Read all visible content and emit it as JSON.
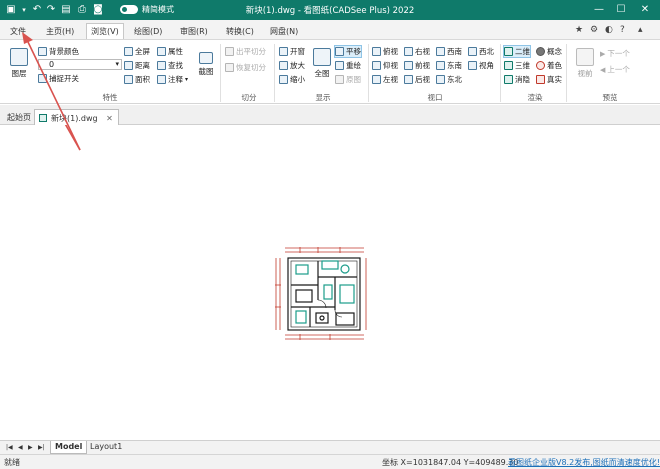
{
  "titlebar": {
    "title": "新块(1).dwg - 看图纸(CADSee Plus) 2022",
    "mode_label": "精简模式",
    "icons": [
      "folder-icon",
      "undo-icon",
      "redo-icon",
      "save-icon",
      "print-icon",
      "camera-icon",
      "minimize-icon",
      "maximize-icon",
      "close-icon"
    ]
  },
  "menu": {
    "tabs": [
      "文件",
      "主页(H)",
      "浏览(V)",
      "绘图(D)",
      "审图(R)",
      "转换(C)",
      "网盘(N)"
    ],
    "active": "浏览(V)"
  },
  "ribbon": {
    "properties": {
      "label": "特性",
      "layer_btn": "图层",
      "bg_color": "背景颜色",
      "layer_value": "0",
      "snap": "捕捉开关",
      "fullscreen": "全屏",
      "attribute": "属性",
      "distance": "距离",
      "find": "查找",
      "area": "面积",
      "annotate": "注释",
      "screenshot": "截图"
    },
    "split": {
      "label": "切分",
      "out_split": "出平切分",
      "restore_split": "恢复切分"
    },
    "display": {
      "label": "显示",
      "window": "开窗",
      "zoom_in": "放大",
      "zoom_out": "缩小",
      "full_view": "全图",
      "pan": "平移",
      "redraw": "重绘",
      "original": "原图"
    },
    "viewport": {
      "label": "视口",
      "items": [
        "俯视",
        "右视",
        "西南",
        "西北",
        "仰视",
        "前视",
        "东南",
        "视角",
        "左视",
        "后视",
        "东北"
      ]
    },
    "render": {
      "label": "渲染",
      "items": [
        "二维",
        "概念",
        "三维",
        "着色",
        "消隐",
        "真实"
      ]
    },
    "preview": {
      "label": "预览",
      "prev_view": "视前",
      "next_one": "下一个",
      "prev_one": "上一个"
    }
  },
  "doctabs": {
    "start": "起始页",
    "file": "新块(1).dwg"
  },
  "sheets": {
    "model": "Model",
    "layout": "Layout1"
  },
  "status": {
    "ready": "就绪",
    "coords": "坐标 X=1031847.04 Y=409489.30",
    "promo": "看图纸企业版V8.2发布,图纸而清速度优化!"
  },
  "colors": {
    "accent": "#0f7a6a",
    "arrow": "#d9534f",
    "drawing": "#1a1a1a",
    "teal_lines": "#1c9c8a"
  }
}
